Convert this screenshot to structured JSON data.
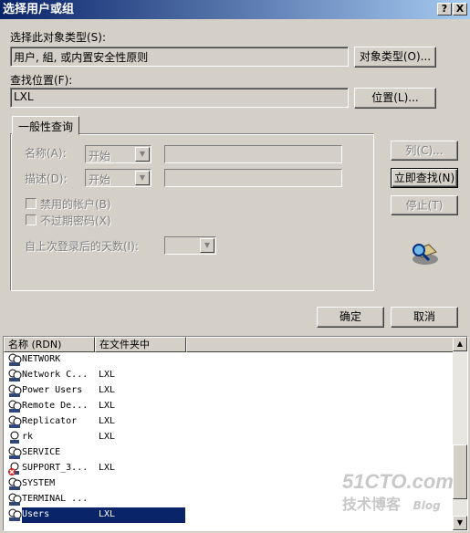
{
  "window": {
    "title": "选择用户或组",
    "help_btn": "?",
    "close_btn": "X"
  },
  "object_type": {
    "label": "选择此对象类型(S):",
    "value": "用户, 組, 或内置安全性原则",
    "button": "对象类型(O)..."
  },
  "location": {
    "label": "查找位置(F):",
    "value": "LXL",
    "button": "位置(L)..."
  },
  "query": {
    "tab": "一般性查询",
    "name_label": "名称(A):",
    "name_mode": "开始",
    "desc_label": "描述(D):",
    "desc_mode": "开始",
    "disabled_accounts": "禁用的帐户(B)",
    "non_expiring_pw": "不过期密码(X)",
    "days_label": "自上次登录后的天数(I):"
  },
  "side_buttons": {
    "columns": "列(C)...",
    "find_now": "立即查找(N)",
    "stop": "停止(T)"
  },
  "dialog_buttons": {
    "ok": "确定",
    "cancel": "取消"
  },
  "results": {
    "col_name": "名称 (RDN)",
    "col_folder": "在文件夹中",
    "rows": [
      {
        "name": "NETWORK",
        "folder": ""
      },
      {
        "name": "Network C...",
        "folder": "LXL"
      },
      {
        "name": "Power Users",
        "folder": "LXL"
      },
      {
        "name": "Remote De...",
        "folder": "LXL"
      },
      {
        "name": "Replicator",
        "folder": "LXL"
      },
      {
        "name": "rk",
        "folder": "LXL"
      },
      {
        "name": "SERVICE",
        "folder": ""
      },
      {
        "name": "SUPPORT_3...",
        "folder": "LXL"
      },
      {
        "name": "SYSTEM",
        "folder": ""
      },
      {
        "name": "TERMINAL ...",
        "folder": ""
      },
      {
        "name": "Users",
        "folder": "LXL"
      }
    ]
  },
  "watermark": {
    "line1": "51CTO.com",
    "line2": "技术博客",
    "line3": "Blog"
  }
}
